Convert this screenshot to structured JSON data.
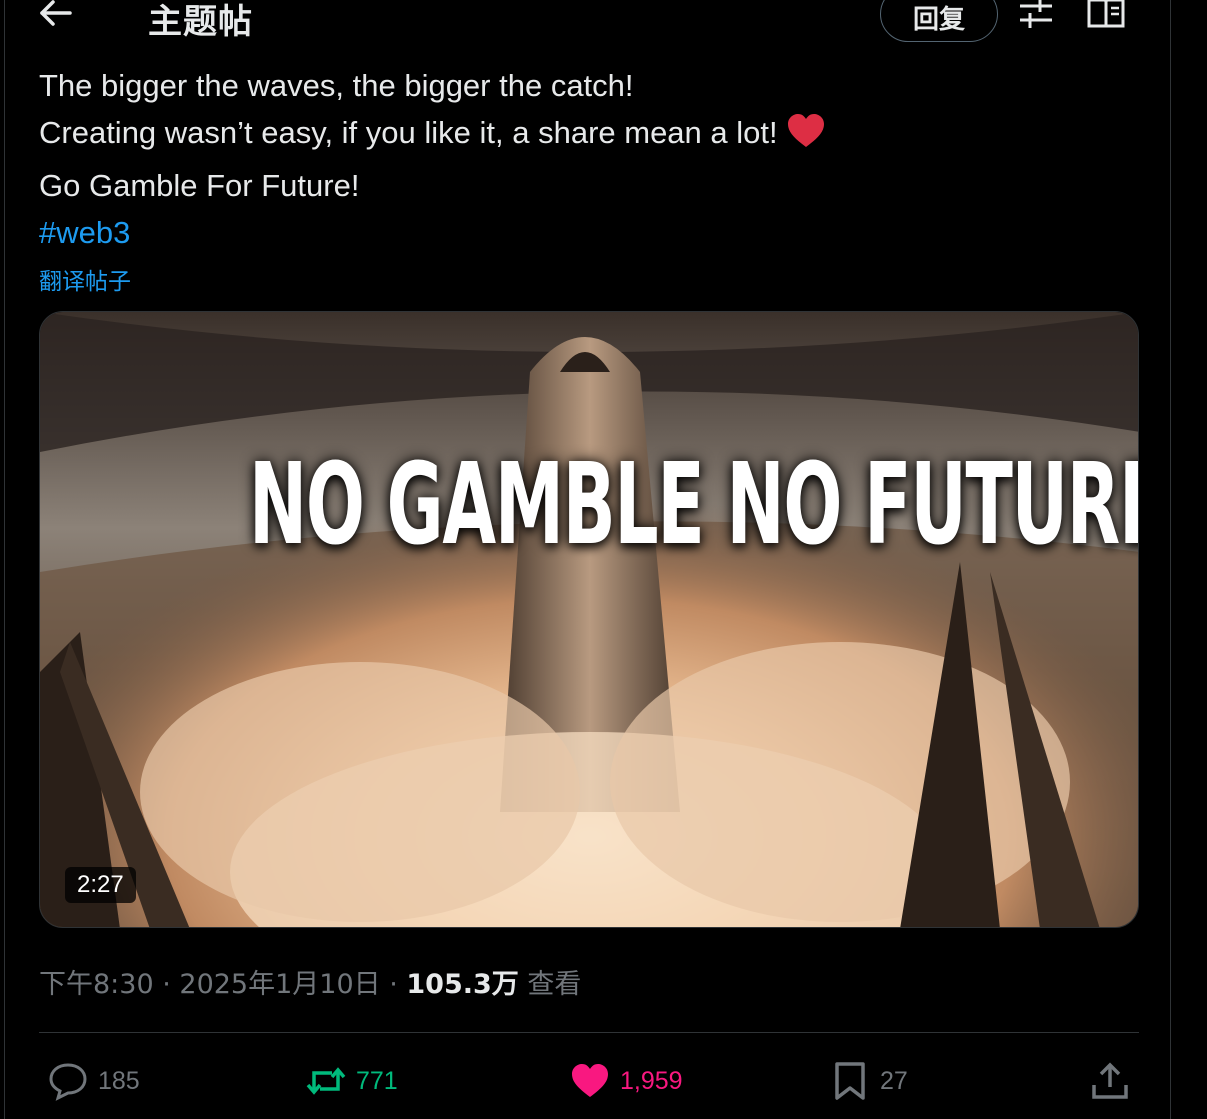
{
  "header": {
    "back_icon": "arrow-left-icon",
    "title": "主题帖",
    "reply_label": "回复",
    "filter_icon": "sliders-icon",
    "reader_icon": "open-book-icon"
  },
  "tweet": {
    "lines": [
      "The bigger the waves, the bigger the catch!",
      "Creating wasn’t easy, if you like it, a share mean a lot!",
      "Go Gamble For Future!"
    ],
    "emoji": "red-heart",
    "hashtag": "#web3",
    "translate_label": "翻译帖子"
  },
  "media": {
    "caption": "NO GAMBLE NO FUTURE",
    "duration": "2:27"
  },
  "meta": {
    "time": "下午8:30",
    "separator": " · ",
    "date": "2025年1月10日",
    "views": "105.3万",
    "views_label": "查看"
  },
  "actions": {
    "replies": "185",
    "retweets": "771",
    "likes": "1,959",
    "bookmarks": "27"
  },
  "colors": {
    "accent": "#1d9bf0",
    "retweet": "#00ba7c",
    "like": "#f91880",
    "muted": "#71767b"
  }
}
